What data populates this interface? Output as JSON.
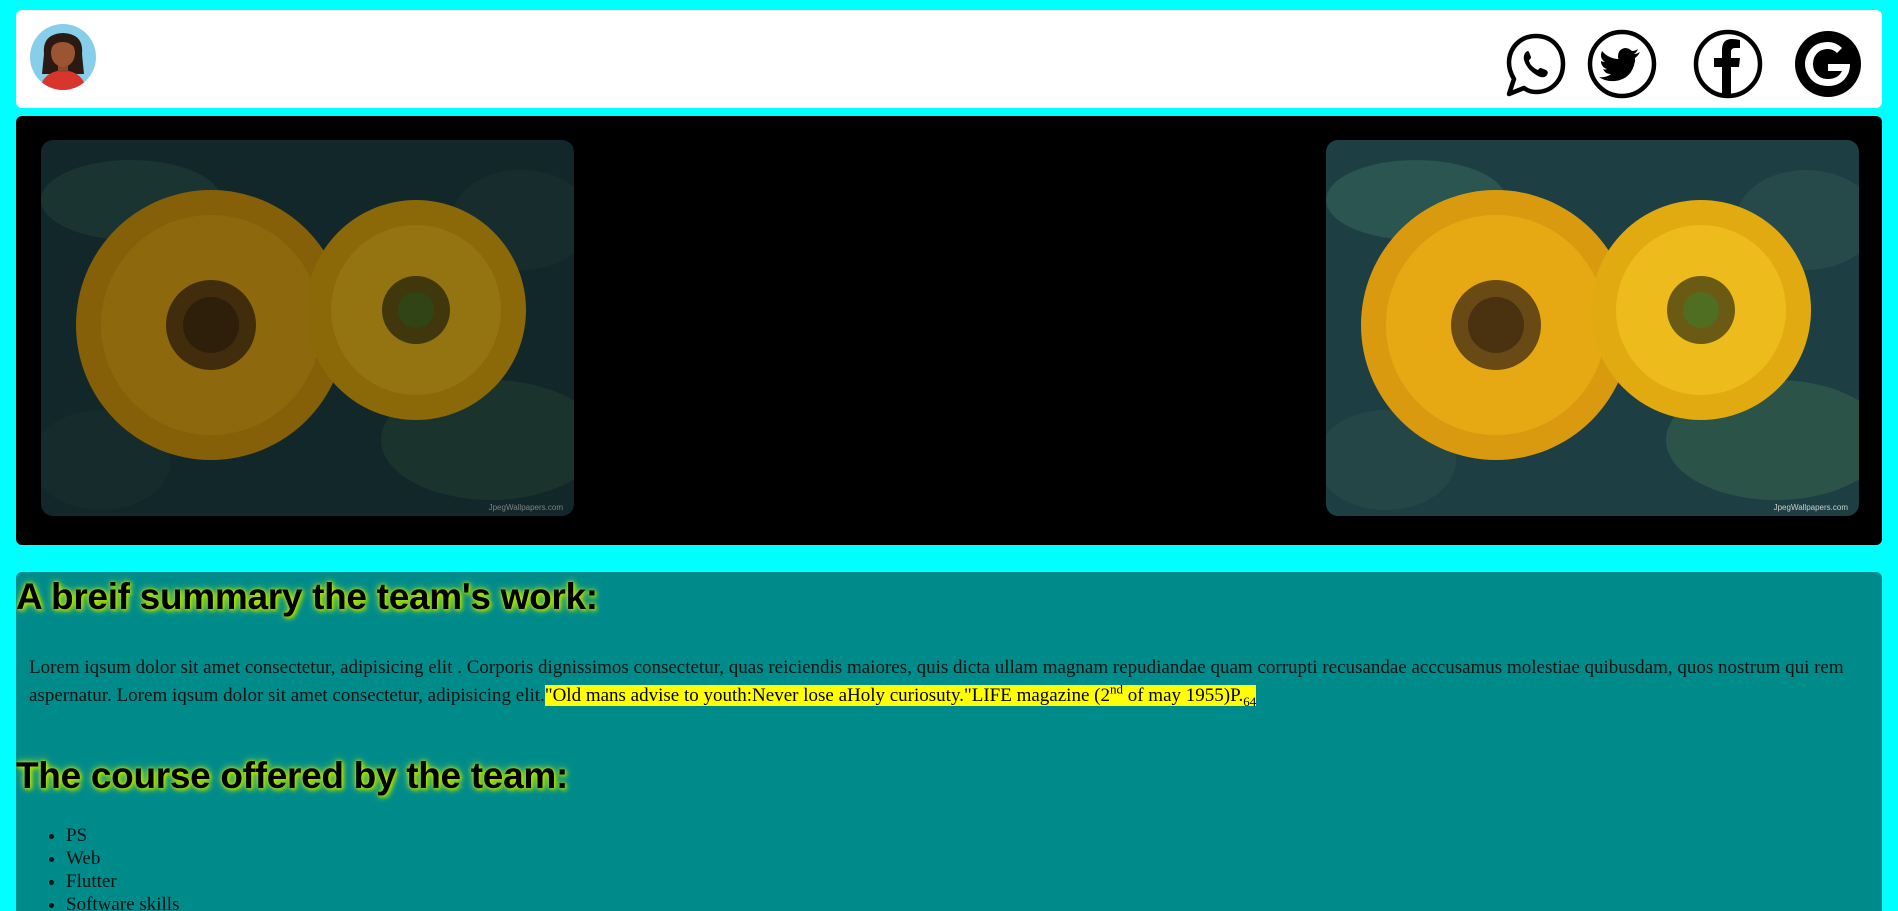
{
  "header": {
    "avatar_icon": "woman-avatar-icon",
    "social_icons": [
      "whatsapp-icon",
      "twitter-icon",
      "facebook-icon",
      "google-icon"
    ]
  },
  "banner": {
    "images": [
      "sunflowers-dimmed-image",
      "sunflowers-image"
    ],
    "watermark": "JpegWallpapers.com"
  },
  "summary": {
    "heading": "A breif summary the team's work:",
    "body": "Lorem iqsum dolor sit amet consectetur, adipisicing elit . Corporis dignissimos consectetur, quas reiciendis maiores, quis dicta ullam magnam repudiandae quam corrupti recusandae acccusamus molestiae quibusdam, quos nostrum qui rem aspernatur. Lorem iqsum dolor sit amet consectetur, adipisicing elit.",
    "quote_a": "\"Old mans advise to youth:Never lose aHoly curiosuty.\"LIFE magazine (2",
    "quote_sup": "nd",
    "quote_b": " of may 1955)P.",
    "quote_sub": "64"
  },
  "courses": {
    "heading": "The course offered by the team:",
    "items": [
      "PS",
      "Web",
      "Flutter",
      "Software skills"
    ]
  },
  "colors": {
    "page_bg": "#00ffff",
    "content_bg": "#008b8b",
    "highlight": "#ffff00"
  }
}
